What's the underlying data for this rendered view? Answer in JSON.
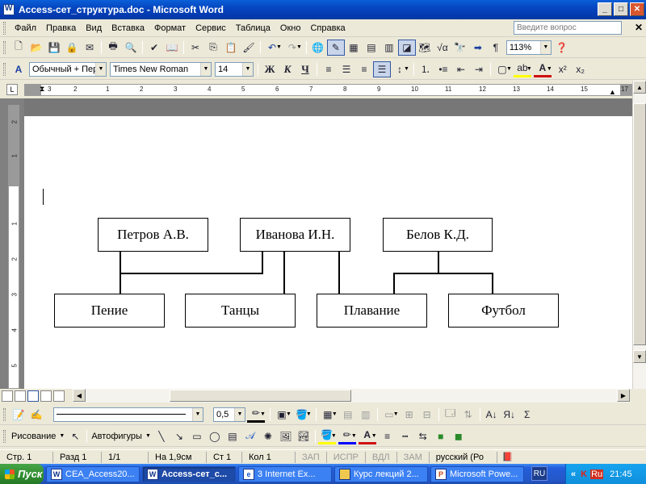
{
  "window": {
    "title": "Access-сет_структура.doc - Microsoft Word"
  },
  "menu": {
    "items": [
      "Файл",
      "Правка",
      "Вид",
      "Вставка",
      "Формат",
      "Сервис",
      "Таблица",
      "Окно",
      "Справка"
    ],
    "help_placeholder": "Введите вопрос"
  },
  "toolbar_standard": {
    "zoom": "113%"
  },
  "toolbar_format": {
    "style": "Обычный + Пер",
    "font": "Times New Roman",
    "size": "14"
  },
  "ruler": {
    "labels": [
      "3",
      "2",
      "1",
      "1",
      "2",
      "3",
      "4",
      "5",
      "6",
      "7",
      "8",
      "9",
      "10",
      "11",
      "12",
      "13",
      "14",
      "15",
      "16",
      "17"
    ]
  },
  "vruler": {
    "labels": [
      "2",
      "1",
      "1",
      "2",
      "3",
      "4",
      "5"
    ]
  },
  "diagram": {
    "people": [
      "Петров А.В.",
      "Иванова И.Н.",
      "Белов К.Д."
    ],
    "activities": [
      "Пение",
      "Танцы",
      "Плавание",
      "Футбол"
    ]
  },
  "drawing_toolbar": {
    "line_width": "0,5"
  },
  "drawing_toolbar2": {
    "draw_label": "Рисование",
    "autoshapes_label": "Автофигуры"
  },
  "status": {
    "page": "Стр. 1",
    "section": "Разд 1",
    "pages": "1/1",
    "at": "На 1,9см",
    "line": "Ст 1",
    "col": "Кол 1",
    "rec": "ЗАП",
    "trk": "ИСПР",
    "ext": "ВДЛ",
    "ovr": "ЗАМ",
    "lang": "русский (Ро"
  },
  "taskbar": {
    "start": "Пуск",
    "buttons": [
      "CEA_Access20...",
      "Access-сет_с...",
      "3 Internet Ex...",
      "Курс лекций 2...",
      "Microsoft Powe..."
    ],
    "lang": "RU",
    "tray_lang": "Ru",
    "clock": "21:45"
  }
}
